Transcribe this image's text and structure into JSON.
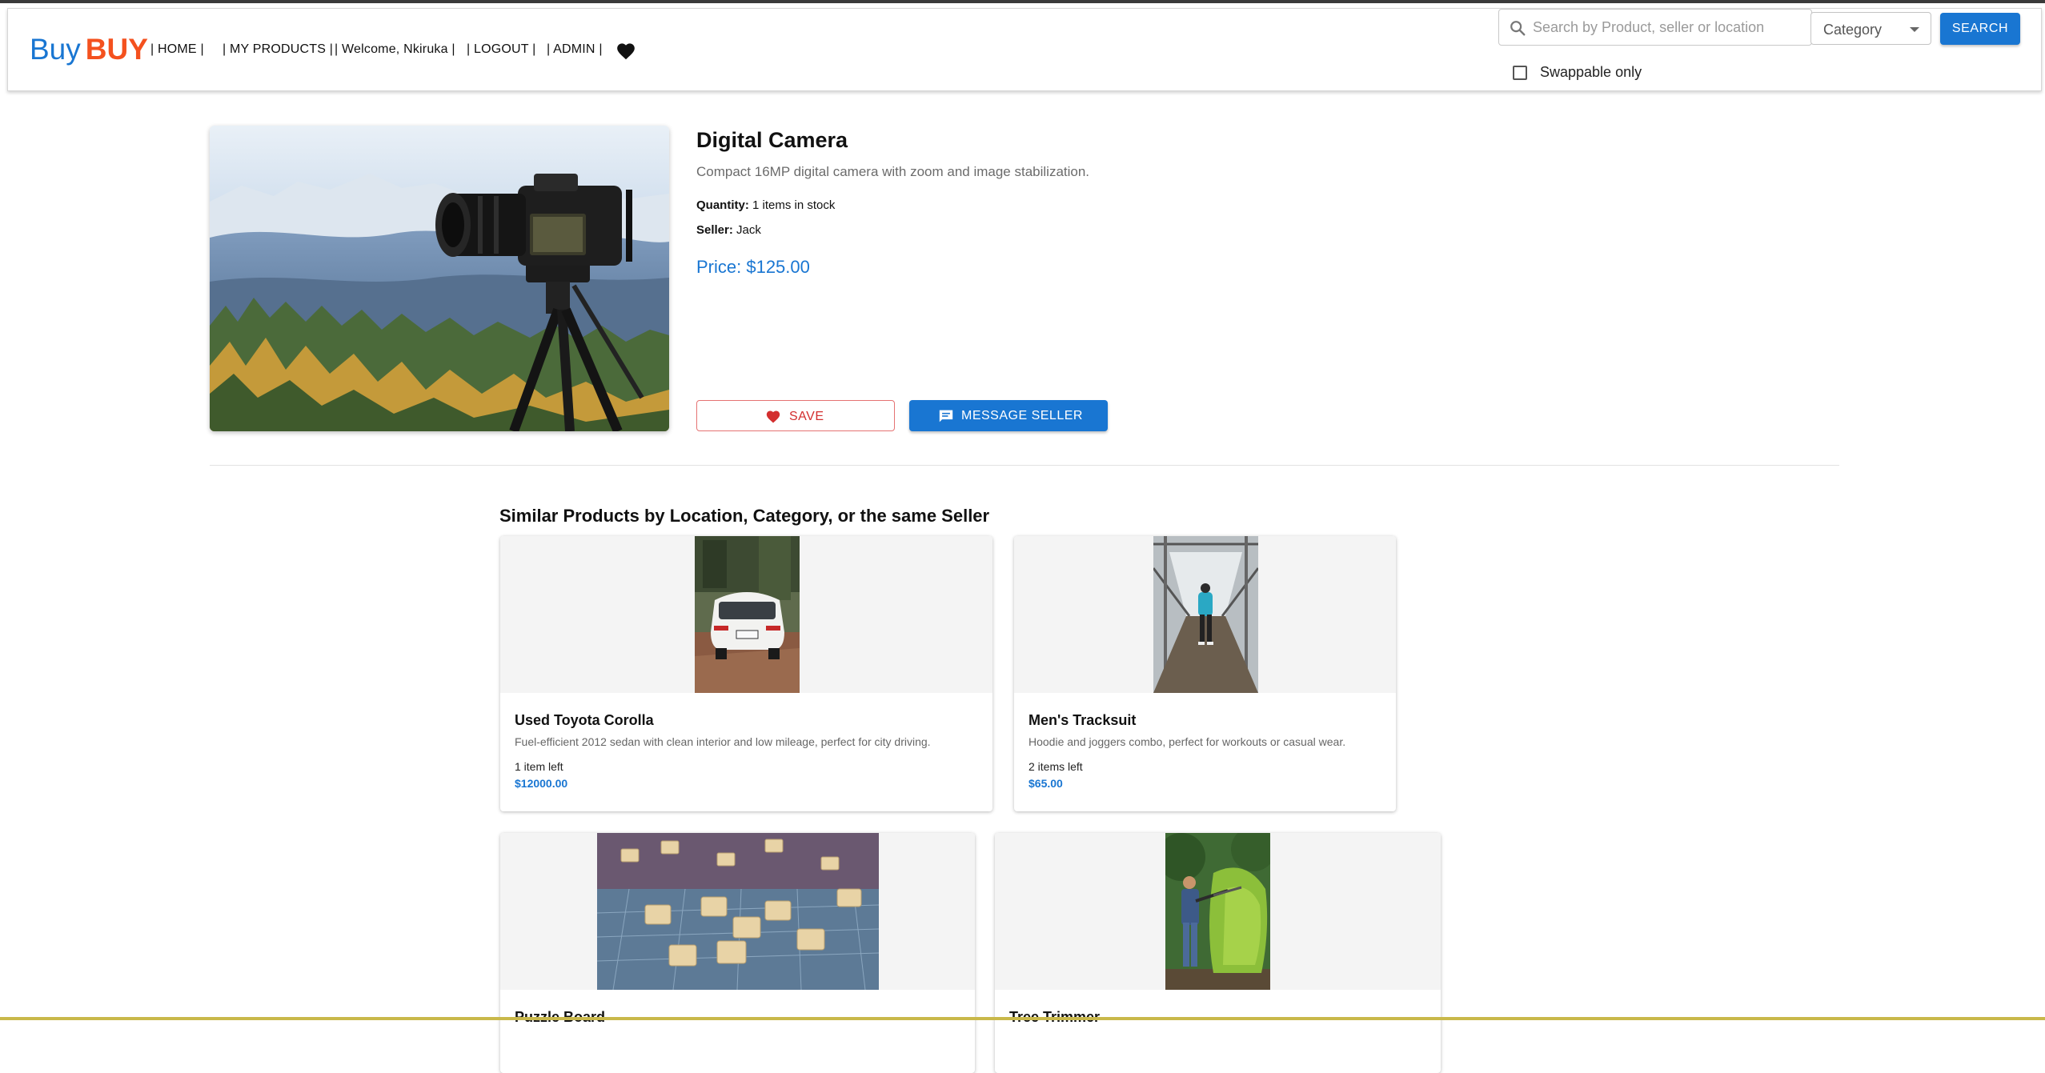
{
  "header": {
    "logo_part1": "Buy",
    "logo_part2": "BUY",
    "nav": {
      "home": "| HOME |",
      "my_products": "| MY PRODUCTS |",
      "welcome": "| Welcome, Nkiruka |",
      "logout": "| LOGOUT |",
      "admin": "| ADMIN |"
    },
    "search_placeholder": "Search by Product, seller or location",
    "search_value": "",
    "category_label": "Category",
    "search_button": "SEARCH",
    "swappable_label": "Swappable only",
    "swappable_checked": false
  },
  "product": {
    "title": "Digital Camera",
    "description": "Compact 16MP digital camera with zoom and image stabilization.",
    "quantity_label": "Quantity:",
    "quantity_value": "1 items in stock",
    "seller_label": "Seller:",
    "seller_value": "Jack",
    "price": "Price: $125.00",
    "save_button": "SAVE",
    "message_button": "MESSAGE SELLER"
  },
  "similar": {
    "title": "Similar Products by Location, Category, or the same Seller",
    "items": [
      {
        "title": "Used Toyota Corolla",
        "description": "Fuel-efficient 2012 sedan with clean interior and low mileage, perfect for city driving.",
        "stock": "1 item left",
        "price": "$12000.00"
      },
      {
        "title": "Men's Tracksuit",
        "description": "Hoodie and joggers combo, perfect for workouts or casual wear.",
        "stock": "2 items left",
        "price": "$65.00"
      },
      {
        "title": "Puzzle Board",
        "description": "",
        "stock": "",
        "price": ""
      },
      {
        "title": "Tree Trimmer",
        "description": "",
        "stock": "",
        "price": ""
      }
    ]
  },
  "colors": {
    "accent": "#1976d2",
    "brand_orange": "#f4511e",
    "save_red": "#d32f2f"
  }
}
